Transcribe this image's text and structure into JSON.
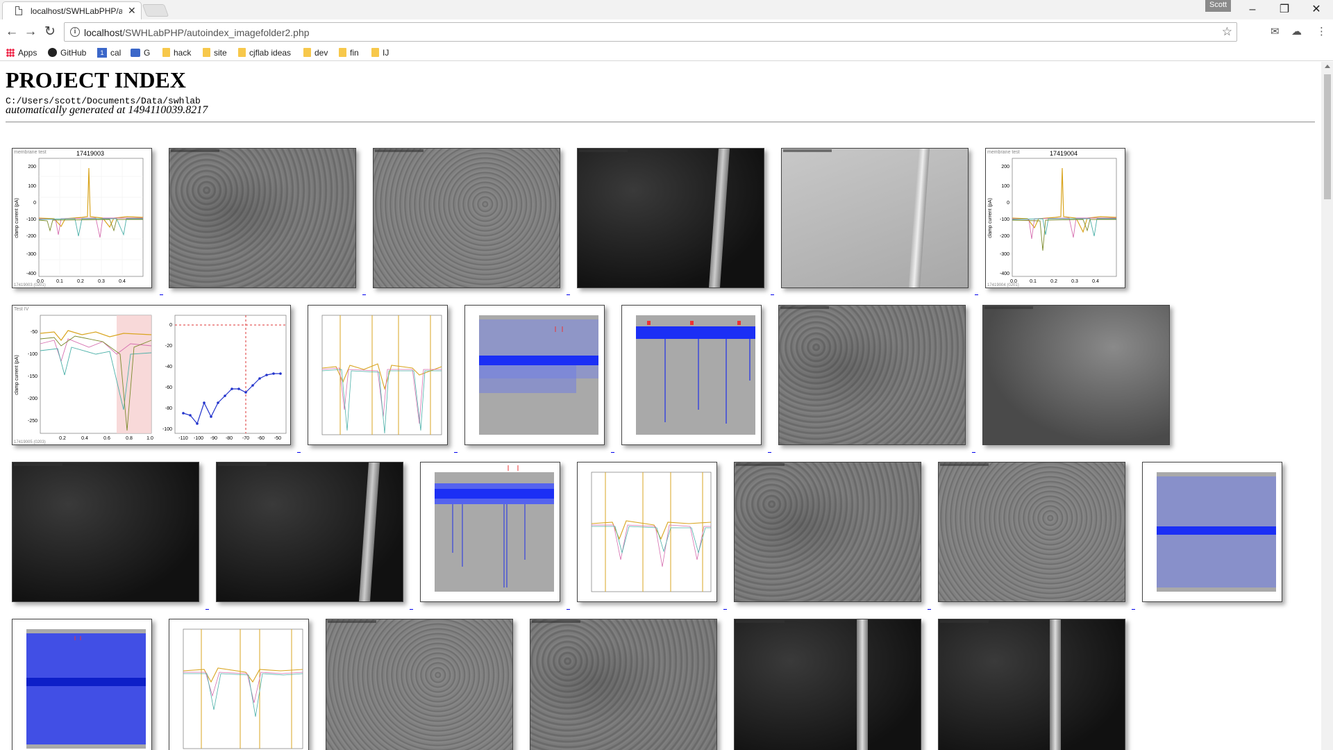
{
  "window": {
    "tab_title": "localhost/SWHLabPHP/a",
    "profile_name": "Scott",
    "minimize": "–",
    "restore": "❐",
    "close": "✕"
  },
  "toolbar": {
    "back": "←",
    "forward": "→",
    "reload": "↻",
    "url_host": "localhost",
    "url_path": "/SWHLabPHP/autoindex_imagefolder2.php",
    "star": "☆",
    "menu": "⋮"
  },
  "bookmarks": [
    {
      "label": "Apps",
      "icon": "apps-icon"
    },
    {
      "label": "GitHub",
      "icon": "github-icon"
    },
    {
      "label": "cal",
      "icon": "calendar-icon"
    },
    {
      "label": "G",
      "icon": "mail-icon"
    },
    {
      "label": "hack",
      "icon": "folder-icon"
    },
    {
      "label": "site",
      "icon": "folder-icon"
    },
    {
      "label": "cjflab ideas",
      "icon": "folder-icon"
    },
    {
      "label": "dev",
      "icon": "folder-icon"
    },
    {
      "label": "fin",
      "icon": "folder-icon"
    },
    {
      "label": "IJ",
      "icon": "folder-icon"
    }
  ],
  "page": {
    "title": "PROJECT INDEX",
    "path": "C:/Users/scott/Documents/Data/swhlab",
    "generated": "automatically generated at 1494110039.8217"
  },
  "plots": {
    "memtest1": {
      "tag": "membrane test",
      "title": "17419003",
      "ylabel": "clamp current (pA)",
      "yticks": [
        "200",
        "100",
        "0",
        "-100",
        "-200",
        "-300",
        "-400"
      ],
      "xticks": [
        "0.0",
        "0.1",
        "0.2",
        "0.3",
        "0.4"
      ],
      "footer": "17419003 (0201)"
    },
    "memtest2": {
      "tag": "membrane test",
      "title": "17419004",
      "ylabel": "clamp current (pA)",
      "yticks": [
        "200",
        "100",
        "0",
        "-100",
        "-200",
        "-300",
        "-400"
      ],
      "xticks": [
        "0.0",
        "0.1",
        "0.2",
        "0.3",
        "0.4"
      ],
      "footer": "17419004 (0201)"
    },
    "iv": {
      "tag": "Test IV",
      "ylabel": "clamp current (pA)",
      "yticks_left": [
        "-50",
        "-100",
        "-150",
        "-200",
        "-250"
      ],
      "xticks_left": [
        "0.2",
        "0.4",
        "0.6",
        "0.8",
        "1.0"
      ],
      "yticks_right": [
        "0",
        "-20",
        "-40",
        "-60",
        "-80",
        "-100"
      ],
      "xticks_right": [
        "-110",
        "-100",
        "-90",
        "-80",
        "-70",
        "-60",
        "-50"
      ],
      "footer": "17419005 (0203)"
    }
  }
}
